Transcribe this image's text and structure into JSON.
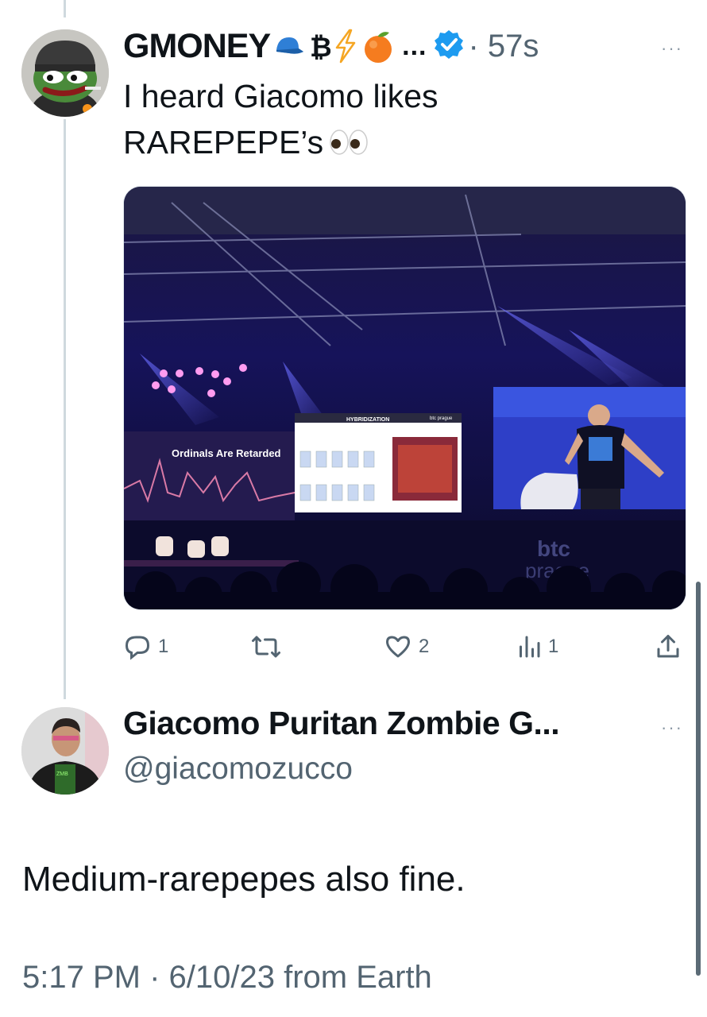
{
  "tweet1": {
    "author": "GMONEY",
    "emojis": [
      "cap-icon",
      "bitcoin-icon",
      "lightning-icon",
      "orange-icon"
    ],
    "ellipsis": "...",
    "time": "· 57s",
    "more": "···",
    "text_line1": "I heard Giacomo likes",
    "text_line2": "RAREPEPE’s",
    "media": {
      "slide_left_text": "Ordinals Are Retarded",
      "slide_center_title": "HYBRIDIZATION",
      "slide_center_logo": "btc prague",
      "stage_logo": "btc",
      "stage_logo_sub": "prague"
    },
    "actions": {
      "replies": "1",
      "likes": "2",
      "views": "1"
    }
  },
  "tweet2": {
    "author": "Giacomo Puritan Zombie G...",
    "handle": "@giacomozucco",
    "more": "···",
    "text": "Medium-rarepepes also fine.",
    "meta": "5:17 PM · 6/10/23 from Earth"
  },
  "colors": {
    "accent": "#1d9bf0",
    "muted": "#536471",
    "text": "#0f1419"
  }
}
